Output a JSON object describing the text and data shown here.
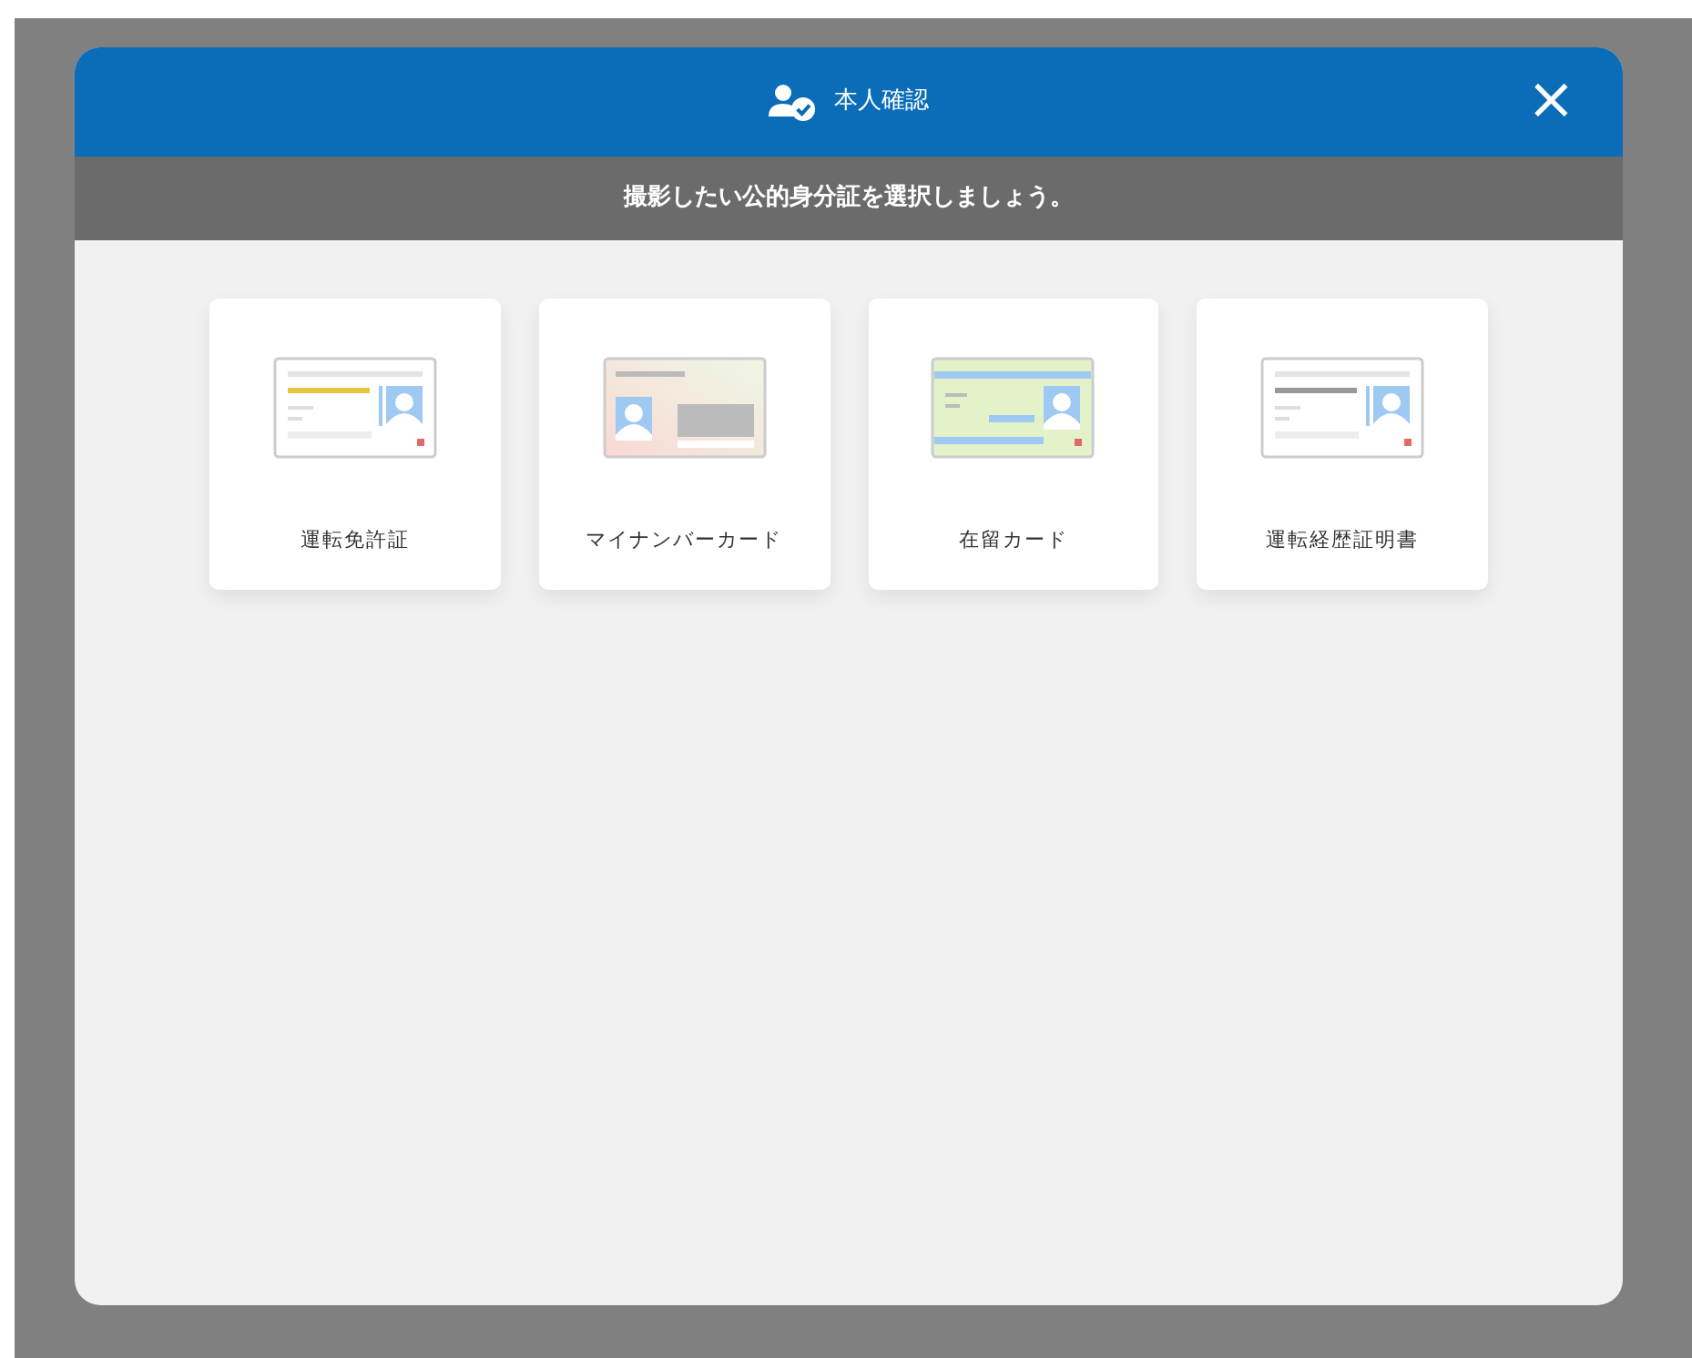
{
  "header": {
    "title": "本人確認",
    "close": "×"
  },
  "instruction": "撮影したい公的身分証を選択しましょう。",
  "documents": [
    {
      "kind": "license",
      "label": "運転免許証"
    },
    {
      "kind": "mynumber",
      "label": "マイナンバーカード"
    },
    {
      "kind": "residence",
      "label": "在留カード"
    },
    {
      "kind": "record",
      "label": "運転経歴証明書"
    }
  ]
}
